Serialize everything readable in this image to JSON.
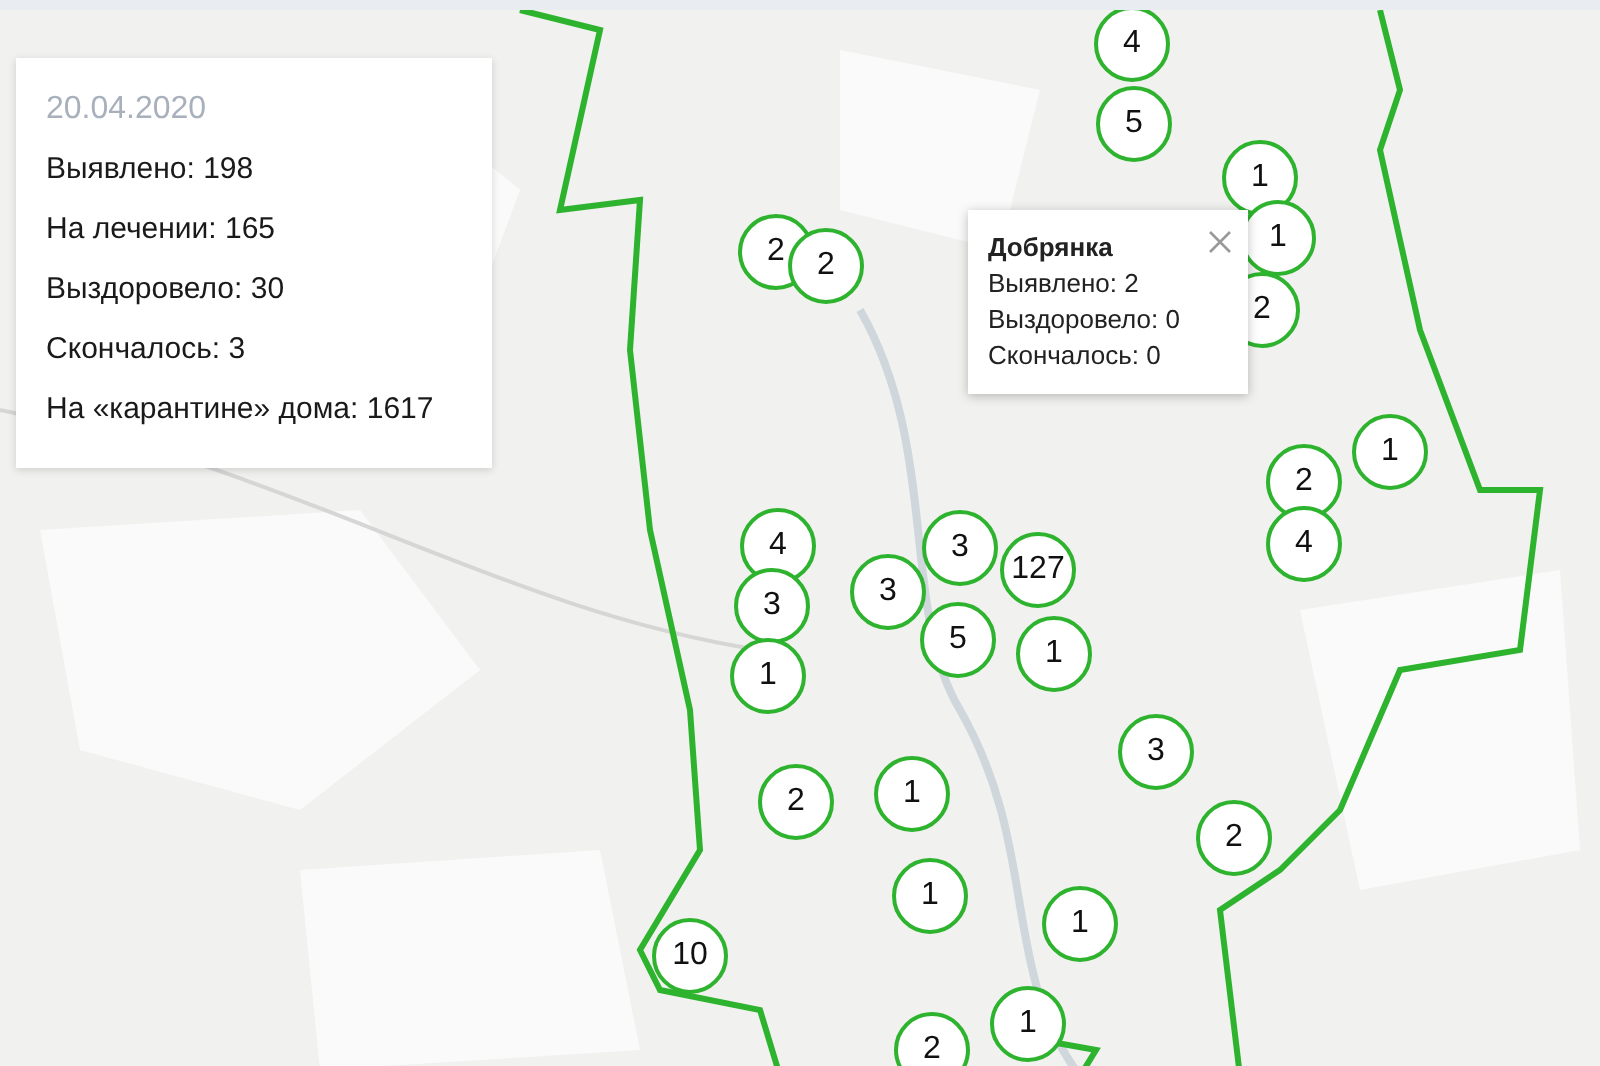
{
  "stats_card": {
    "date": "20.04.2020",
    "lines": [
      "Выявлено: 198",
      "На лечении: 165",
      "Выздоровело: 30",
      "Скончалось: 3",
      "На «карантине» дома: 1617"
    ]
  },
  "map": {
    "kind": "picture",
    "clusters": [
      {
        "count": "4"
      },
      {
        "count": "5"
      },
      {
        "count": "1"
      },
      {
        "count": "1"
      },
      {
        "count": "2"
      },
      {
        "count": "2"
      },
      {
        "count": "2"
      },
      {
        "count": "1"
      },
      {
        "count": "2"
      },
      {
        "count": "4"
      },
      {
        "count": "3"
      },
      {
        "count": "4"
      },
      {
        "count": "127"
      },
      {
        "count": "3"
      },
      {
        "count": "3"
      },
      {
        "count": "5"
      },
      {
        "count": "1"
      },
      {
        "count": "1"
      },
      {
        "count": "3"
      },
      {
        "count": "2"
      },
      {
        "count": "1"
      },
      {
        "count": "2"
      },
      {
        "count": "1"
      },
      {
        "count": "1"
      },
      {
        "count": "10"
      },
      {
        "count": "1"
      },
      {
        "count": "2"
      }
    ],
    "popup": {
      "title": "Добрянка",
      "lines": [
        "Выявлено: 2",
        "Выздоровело: 0",
        "Скончалось: 0"
      ]
    }
  }
}
